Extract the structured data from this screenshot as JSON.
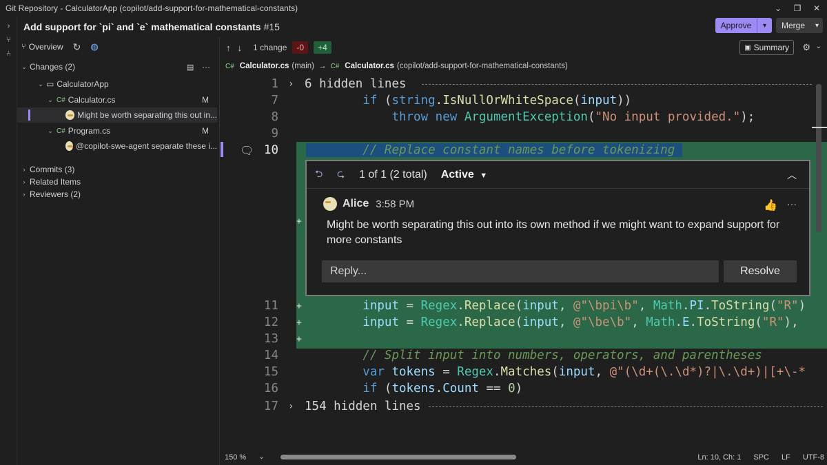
{
  "window": {
    "title": "Git Repository - CalculatorApp (copilot/add-support-for-mathematical-constants)"
  },
  "header": {
    "title": "Add support for `pi` and `e` mathematical constants",
    "number": "#15",
    "approve_label": "Approve",
    "merge_label": "Merge"
  },
  "sidebar": {
    "overview_label": "Overview",
    "changes_label": "Changes (2)",
    "project": "CalculatorApp",
    "files": [
      {
        "lang": "C#",
        "name": "Calculator.cs",
        "status": "M",
        "comment": "Might be worth separating this out in..."
      },
      {
        "lang": "C#",
        "name": "Program.cs",
        "status": "M",
        "comment": "@copilot-swe-agent separate these i..."
      }
    ],
    "commits_label": "Commits (3)",
    "related_label": "Related Items",
    "reviewers_label": "Reviewers (2)"
  },
  "toolbar": {
    "change_count": "1 change",
    "removed": "-0",
    "added": "+4",
    "summary_label": "Summary"
  },
  "path": {
    "lang": "C#",
    "left_file": "Calculator.cs",
    "left_branch": "(main)",
    "arrow": "→",
    "right_file": "Calculator.cs",
    "right_branch": "(copilot/add-support-for-mathematical-constants)"
  },
  "code": {
    "hidden_top": {
      "ln": "1",
      "text": "6 hidden lines"
    },
    "l7": "7",
    "l8": "8",
    "l9": "9",
    "l10": "10",
    "l11": "11",
    "l12": "12",
    "l13": "13",
    "l14": "14",
    "l15": "15",
    "l16": "16",
    "hidden_bottom": {
      "ln": "17",
      "text": "154 hidden lines"
    },
    "plus": "+"
  },
  "comment": {
    "counter": "1 of 1 (2 total)",
    "state": "Active",
    "author": "Alice",
    "time": "3:58 PM",
    "body": "Might be worth separating this out into its own method if we might want to expand support for more constants",
    "reply_placeholder": "Reply...",
    "resolve_label": "Resolve"
  },
  "status": {
    "zoom": "150 %",
    "position": "Ln: 10, Ch: 1",
    "whitespace": "SPC",
    "eol": "LF",
    "encoding": "UTF-8"
  },
  "colors": {
    "accent": "#9d8af5",
    "added_bg": "#2a6848",
    "removed_badge": "#5c1414"
  }
}
